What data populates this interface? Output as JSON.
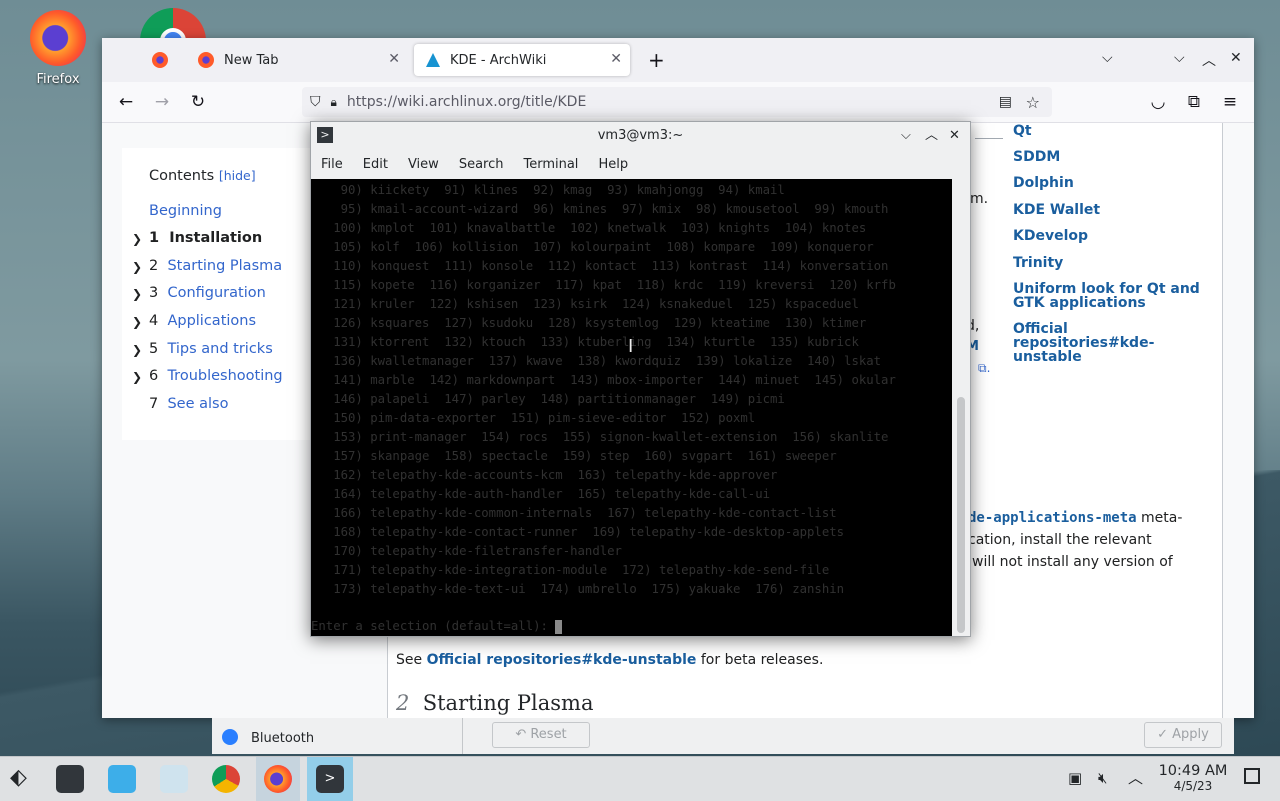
{
  "desktop": {
    "firefox_label": "Firefox"
  },
  "browser": {
    "tabs": [
      {
        "label": ""
      },
      {
        "label": "New Tab"
      },
      {
        "label": "KDE - ArchWiki"
      }
    ],
    "new_tab": "+",
    "url": "https://wiki.archlinux.org/title/KDE",
    "toc": {
      "title": "Contents",
      "hide": "[hide]",
      "items": [
        {
          "num": "",
          "label": "Beginning"
        },
        {
          "num": "1",
          "label": "Installation"
        },
        {
          "num": "2",
          "label": "Starting Plasma"
        },
        {
          "num": "3",
          "label": "Configuration"
        },
        {
          "num": "4",
          "label": "Applications"
        },
        {
          "num": "5",
          "label": "Tips and tricks"
        },
        {
          "num": "6",
          "label": "Troubleshooting"
        },
        {
          "num": "7",
          "label": "See also"
        }
      ]
    },
    "side_links": [
      "Qt",
      "SDDM",
      "Dolphin",
      "KDE Wallet",
      "KDevelop",
      "Trinity",
      "Uniform look for Qt and GTK applications",
      "Official repositories#kde-unstable"
    ],
    "body": {
      "frag_m": "m.",
      "frag_d": "d,",
      "frag_M": "M",
      "line_meta_link": "de-applications-meta",
      "line_meta_tail": "meta-",
      "line2": "cation, install the relevant",
      "line3": "will not install any version of",
      "see_prefix": "See",
      "see_link": "Official repositories#kde-unstable",
      "see_suffix": "for beta releases.",
      "section_num": "2",
      "section_title": "Starting Plasma"
    }
  },
  "settings_window": {
    "bluetooth": "Bluetooth",
    "reset": "Reset",
    "apply": "Apply"
  },
  "terminal": {
    "title": "vm3@vm3:~",
    "menu": [
      "File",
      "Edit",
      "View",
      "Search",
      "Terminal",
      "Help"
    ],
    "lines": [
      " 90) kiickety  91) klines  92) kmag  93) kmahjongg  94) kmail",
      " 95) kmail-account-wizard  96) kmines  97) kmix  98) kmousetool  99) kmouth",
      "100) kmplot  101) knavalbattle  102) knetwalk  103) knights  104) knotes",
      "105) kolf  106) kollision  107) kolourpaint  108) kompare  109) konqueror",
      "110) konquest  111) konsole  112) kontact  113) kontrast  114) konversation",
      "115) kopete  116) korganizer  117) kpat  118) krdc  119) kreversi  120) krfb",
      "121) kruler  122) kshisen  123) ksirk  124) ksnakeduel  125) kspaceduel",
      "126) ksquares  127) ksudoku  128) ksystemlog  129) kteatime  130) ktimer",
      "131) ktorrent  132) ktouch  133) ktuberling  134) kturtle  135) kubrick",
      "136) kwalletmanager  137) kwave  138) kwordquiz  139) lokalize  140) lskat",
      "141) marble  142) markdownpart  143) mbox-importer  144) minuet  145) okular",
      "146) palapeli  147) parley  148) partitionmanager  149) picmi",
      "150) pim-data-exporter  151) pim-sieve-editor  152) poxml",
      "153) print-manager  154) rocs  155) signon-kwallet-extension  156) skanlite",
      "157) skanpage  158) spectacle  159) step  160) svgpart  161) sweeper",
      "162) telepathy-kde-accounts-kcm  163) telepathy-kde-approver",
      "164) telepathy-kde-auth-handler  165) telepathy-kde-call-ui",
      "166) telepathy-kde-common-internals  167) telepathy-kde-contact-list",
      "168) telepathy-kde-contact-runner  169) telepathy-kde-desktop-applets",
      "170) telepathy-kde-filetransfer-handler",
      "171) telepathy-kde-integration-module  172) telepathy-kde-send-file",
      "173) telepathy-kde-text-ui  174) umbrello  175) yakuake  176) zanshin"
    ],
    "prompt": "Enter a selection (default=all): "
  },
  "taskbar": {
    "time": "10:49 AM",
    "date": "4/5/23"
  }
}
